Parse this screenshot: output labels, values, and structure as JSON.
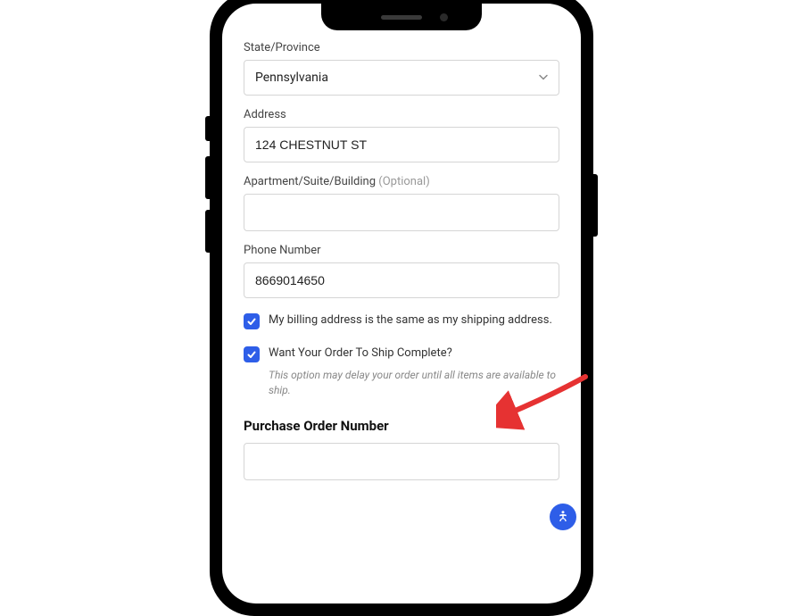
{
  "form": {
    "state": {
      "label": "State/Province",
      "value": "Pennsylvania"
    },
    "address": {
      "label": "Address",
      "value": "124 CHESTNUT ST"
    },
    "apartment": {
      "label_main": "Apartment/Suite/Building ",
      "label_optional": "(Optional)",
      "value": ""
    },
    "phone": {
      "label": "Phone Number",
      "value": "8669014650"
    },
    "billing_same": {
      "checked": true,
      "label": "My billing address is the same as my shipping address."
    },
    "ship_complete": {
      "checked": true,
      "label": "Want Your Order To Ship Complete?",
      "note": "This option may delay your order until all items are available to ship."
    },
    "po_number": {
      "title": "Purchase Order Number",
      "value": ""
    }
  },
  "colors": {
    "accent": "#2e5ee8",
    "arrow": "#e63232"
  }
}
